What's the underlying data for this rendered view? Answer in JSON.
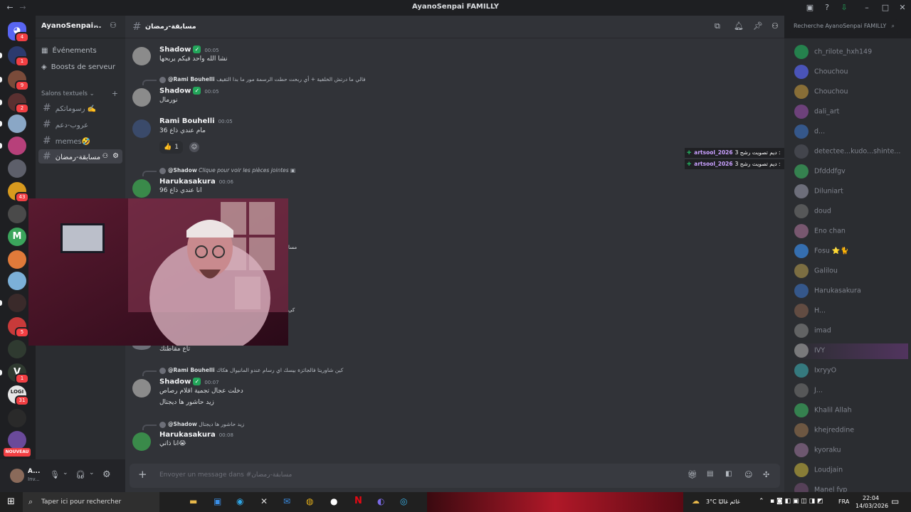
{
  "window": {
    "title": "AyanoSenpai FAMILLY"
  },
  "servers": [
    {
      "badge": "4",
      "color": "#5865f2",
      "icon": "discord-logo"
    },
    {
      "badge": "1",
      "color": "#2b3a6e"
    },
    {
      "badge": "9",
      "color": "#7a4b3a"
    },
    {
      "badge": "2",
      "color": "#5a3030"
    },
    {
      "badge": "",
      "color": "#8aa7c6"
    },
    {
      "badge": "",
      "color": "#b7407a"
    },
    {
      "badge": "",
      "color": "#5d5f6a"
    },
    {
      "badge": "43",
      "color": "#d89a1e"
    },
    {
      "badge": "",
      "color": "#4a4a4a"
    },
    {
      "badge": "",
      "color": "#3ba55c",
      "letter": "M"
    },
    {
      "badge": "",
      "color": "#e07a3a"
    },
    {
      "badge": "",
      "color": "#7cb0d8"
    },
    {
      "badge": "",
      "color": "#3a2a2a"
    },
    {
      "badge": "5",
      "color": "#c83a3a"
    },
    {
      "badge": "",
      "color": "#2f3a30"
    },
    {
      "badge": "1",
      "color": "#2f3a30",
      "letter": "V"
    },
    {
      "badge": "31",
      "color": "#e6e6e6",
      "letter": "LOGI"
    },
    {
      "badge": "",
      "color": "#2a2a2a"
    },
    {
      "badge": "",
      "color": "#6a4a9a"
    }
  ],
  "nouveau_label": "NOUVEAU",
  "guild": {
    "name": "AyanoSenpai..."
  },
  "nav": {
    "events": "Événements",
    "boosts": "Boosts de serveur"
  },
  "category": "Salons textuels",
  "channels": [
    {
      "name": "رسوماتكم ✍️"
    },
    {
      "name": "عروب-دعم"
    },
    {
      "name": "memes🤣"
    },
    {
      "name": "مسابقة-رمضان",
      "active": true
    }
  ],
  "header": {
    "channel": "مسابقة-رمضان",
    "search_placeholder": "Recherche AyanoSenpai FAMILLY"
  },
  "messages": [
    {
      "user": "Shadow",
      "time": "00:05",
      "verified": true,
      "text": "نشا الله واحد فيكم يربحها",
      "color": "#8b8b8b"
    },
    {
      "reply_user": "@Rami Bouhelli",
      "reply_text": "فالي ما درتش الخلفية + أي ربحت حطت الرسمة مور ما بدا الثقيف",
      "user": "Shadow",
      "time": "00:05",
      "verified": true,
      "text": "نورمال",
      "color": "#8b8b8b"
    },
    {
      "user": "Rami Bouhelli",
      "time": "00:05",
      "verified": false,
      "text": "مام عندي ذاع 36",
      "color": "#3a4a6a",
      "reaction": {
        "emoji": "👍",
        "count": "1"
      }
    },
    {
      "reply_user": "@Shadow",
      "reply_text": "Clique pour voir les pièces jointes",
      "user": "Harukasakura",
      "time": "00:06",
      "verified": false,
      "text": "انا عندي ذاع 96",
      "color": "#3a8a4a"
    },
    {
      "text": "تاع مقاطتك"
    },
    {
      "reply_user": "@Rami Bouhelli",
      "reply_text": "كين شاوريتا فالجائزة بيسك اي رسام عندو المانيوال هكاك",
      "user": "Shadow",
      "time": "00:07",
      "verified": true,
      "text": "دخلت عجال تجمية اقلام رصاص",
      "text2": "زيد حاشور ها ديجتال",
      "color": "#8b8b8b"
    },
    {
      "reply_user": "@Shadow",
      "reply_text": "زيد حاشور ها ديجتال",
      "user": "Harukasakura",
      "time": "00:08",
      "verified": false,
      "text": "انا ذاتي😭",
      "color": "#3a8a4a"
    }
  ],
  "fragments": [
    "مسا",
    "كي"
  ],
  "overlay": [
    {
      "user": "artsool_2026",
      "text": "ديم تصويت رشح 3 :"
    },
    {
      "user": "artsool_2026",
      "text": "ديم تصويت رشح 3 :"
    }
  ],
  "members": [
    "ch_rilote_hxh149",
    "Chouchou",
    "Chouchou",
    "dali_art",
    "d...",
    "detectee...kudo...shinte...",
    "Dfdddfgv",
    "Diluniart",
    "doud",
    "Eno chan",
    "Fosu ⭐🐈",
    "Galilou",
    "Harukasakura",
    "H...",
    "imad",
    "IVY",
    "IxryyO",
    "J...",
    "Khalil Allah",
    "khejreddine",
    "kyoraku",
    "Loudjain",
    "Manel fyp"
  ],
  "composer": {
    "placeholder": "Envoyer un message dans #مسابقة-رمضان"
  },
  "user_panel": {
    "name": "A...",
    "status": "Inv..."
  },
  "taskbar": {
    "search_placeholder": "Taper ici pour rechercher",
    "weather": "3°C غائم غالبًا",
    "lang": "FRA",
    "time": "22:04",
    "date": "14/03/2026"
  }
}
